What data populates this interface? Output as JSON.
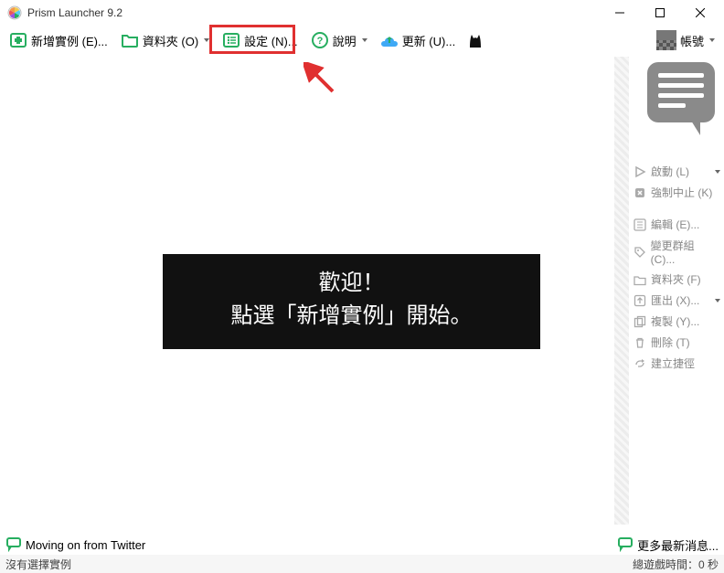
{
  "window": {
    "title": "Prism Launcher 9.2"
  },
  "toolbar": {
    "add_instance": "新增實例 (E)...",
    "folders": "資料夾 (O)",
    "settings": "設定 (N)...",
    "help": "說明",
    "update": "更新 (U)...",
    "accounts": "帳號"
  },
  "side": {
    "launch": "啟動 (L)",
    "kill": "強制中止 (K)",
    "edit": "編輯 (E)...",
    "change_group": "變更群組 (C)...",
    "folder": "資料夾 (F)",
    "export": "匯出 (X)...",
    "copy": "複製 (Y)...",
    "delete": "刪除 (T)",
    "create_shortcut": "建立捷徑"
  },
  "welcome": {
    "line1": "歡迎！",
    "line2": "點選「新增實例」開始。"
  },
  "bottom": {
    "news": "Moving on from Twitter",
    "more_news": "更多最新消息..."
  },
  "status": {
    "no_selection": "沒有選擇實例",
    "total_playtime_label": "總遊戲時間：",
    "total_playtime_value": "0 秒"
  }
}
